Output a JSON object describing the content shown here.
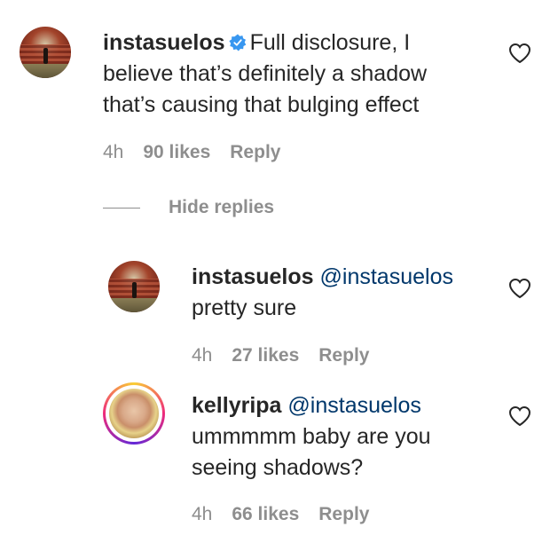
{
  "comments": [
    {
      "username": "instasuelos",
      "verified": true,
      "text_lines": [
        "Full disclosure, I",
        "believe that’s definitely a shadow",
        "that’s causing that bulging effect"
      ],
      "time": "4h",
      "likes": "90 likes",
      "reply": "Reply",
      "avatar": "theater-seats-avatar"
    }
  ],
  "hide_replies": "Hide replies",
  "replies": [
    {
      "username": "instasuelos",
      "mention": "@instasuelos",
      "text_lines": [
        "pretty sure"
      ],
      "time": "4h",
      "likes": "27 likes",
      "reply": "Reply",
      "avatar": "theater-seats-avatar"
    },
    {
      "username": "kellyripa",
      "mention": "@instasuelos",
      "text_lines": [
        "ummmmm baby are you",
        "seeing shadows?"
      ],
      "time": "4h",
      "likes": "66 likes",
      "reply": "Reply",
      "avatar": "portrait-avatar-story-ring"
    }
  ],
  "icons": {
    "like": "heart-outline-icon",
    "verified": "verified-badge-icon"
  },
  "colors": {
    "mention": "#00376b",
    "meta": "#8e8e8e",
    "verified": "#3897f0"
  }
}
